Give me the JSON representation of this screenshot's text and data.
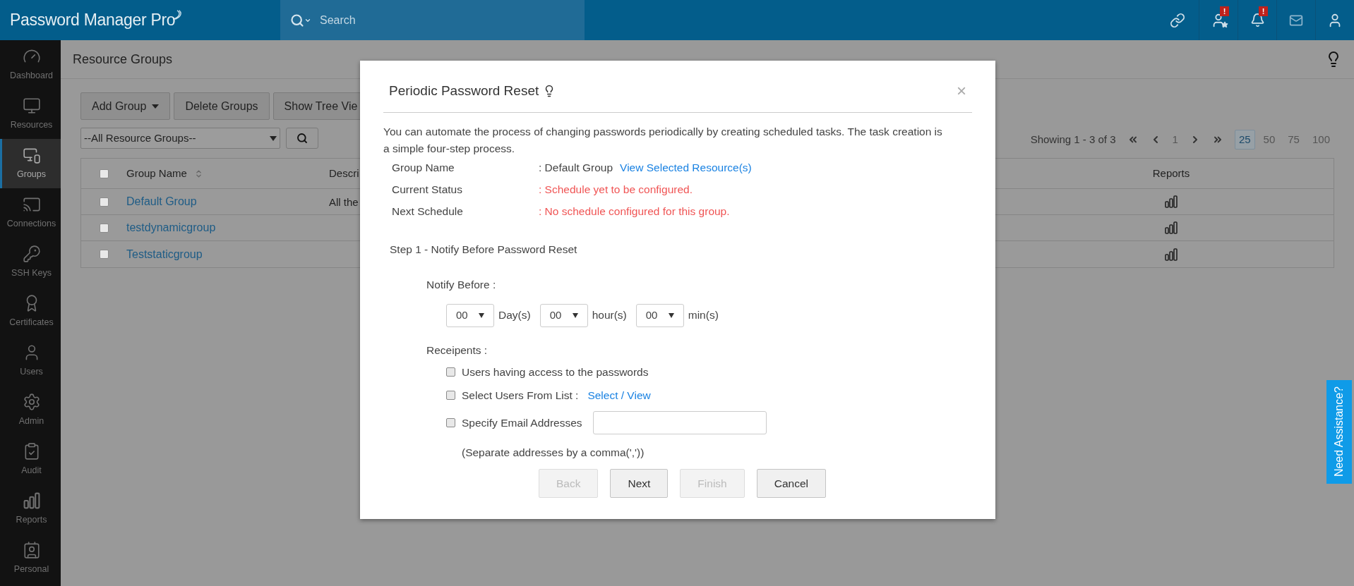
{
  "header": {
    "logo": "Password Manager Pro",
    "search": {
      "placeholder": "Search"
    },
    "badges": [
      "!",
      "!"
    ]
  },
  "sidebar": {
    "items": [
      {
        "label": "Dashboard",
        "selected": false
      },
      {
        "label": "Resources",
        "selected": false
      },
      {
        "label": "Groups",
        "selected": true
      },
      {
        "label": "Connections",
        "selected": false
      },
      {
        "label": "SSH Keys",
        "selected": false
      },
      {
        "label": "Certificates",
        "selected": false
      },
      {
        "label": "Users",
        "selected": false
      },
      {
        "label": "Admin",
        "selected": false
      },
      {
        "label": "Audit",
        "selected": false
      },
      {
        "label": "Reports",
        "selected": false
      },
      {
        "label": "Personal",
        "selected": false
      }
    ]
  },
  "page": {
    "title": "Resource Groups"
  },
  "toolbar": {
    "buttons": [
      "Add Group",
      "Delete Groups",
      "Show Tree Vie"
    ]
  },
  "filter": {
    "value": "--All Resource Groups--"
  },
  "pagination": {
    "summary": "Showing 1 - 3 of 3",
    "page": "1",
    "page_sizes": [
      {
        "label": "25",
        "selected": true
      },
      {
        "label": "50",
        "selected": false
      },
      {
        "label": "75",
        "selected": false
      },
      {
        "label": "100",
        "selected": false
      }
    ]
  },
  "table": {
    "select_all": {
      "checked": false
    },
    "columns": [
      "Group Name",
      "Descri",
      "Reports"
    ],
    "rows": [
      {
        "name": "Default Group",
        "description": "All the",
        "checked": false
      },
      {
        "name": "testdynamicgroup",
        "checked": false
      },
      {
        "name": "Teststaticgroup",
        "checked": false
      }
    ]
  },
  "dialog": {
    "title": "Periodic Password Reset",
    "close": "×",
    "intro": "You can automate the process of changing passwords periodically by creating scheduled tasks. The task creation is a simple four-step process.",
    "info": [
      {
        "label": "Group Name",
        "value": ": Default Group",
        "link": "View Selected Resource(s)",
        "kind": "normal"
      },
      {
        "label": "Current Status",
        "value": ": Schedule yet to be configured.",
        "kind": "alert"
      },
      {
        "label": "Next Schedule",
        "value": ": No schedule configured for this group.",
        "kind": "alert"
      }
    ],
    "step": "Step 1 - Notify Before Password Reset",
    "notify_label": "Notify Before :",
    "timers": [
      {
        "value": "00",
        "unit": "Day(s)"
      },
      {
        "value": "00",
        "unit": "hour(s)"
      },
      {
        "value": "00",
        "unit": "min(s)"
      }
    ],
    "recipients_label": "Receipents :",
    "recipients": [
      {
        "label": "Users having access to the passwords",
        "checked": false,
        "kind": "plain"
      },
      {
        "label": "Select Users From List :",
        "link": "Select / View",
        "checked": false,
        "kind": "link"
      },
      {
        "label": "Specify Email Addresses",
        "checked": false,
        "kind": "input"
      }
    ],
    "note": "(Separate addresses by a comma(','))",
    "buttons": [
      {
        "label": "Back",
        "disabled": true
      },
      {
        "label": "Next",
        "disabled": false
      },
      {
        "label": "Finish",
        "disabled": true
      },
      {
        "label": "Cancel",
        "disabled": false
      }
    ]
  },
  "assistance": "Need Assistance?"
}
